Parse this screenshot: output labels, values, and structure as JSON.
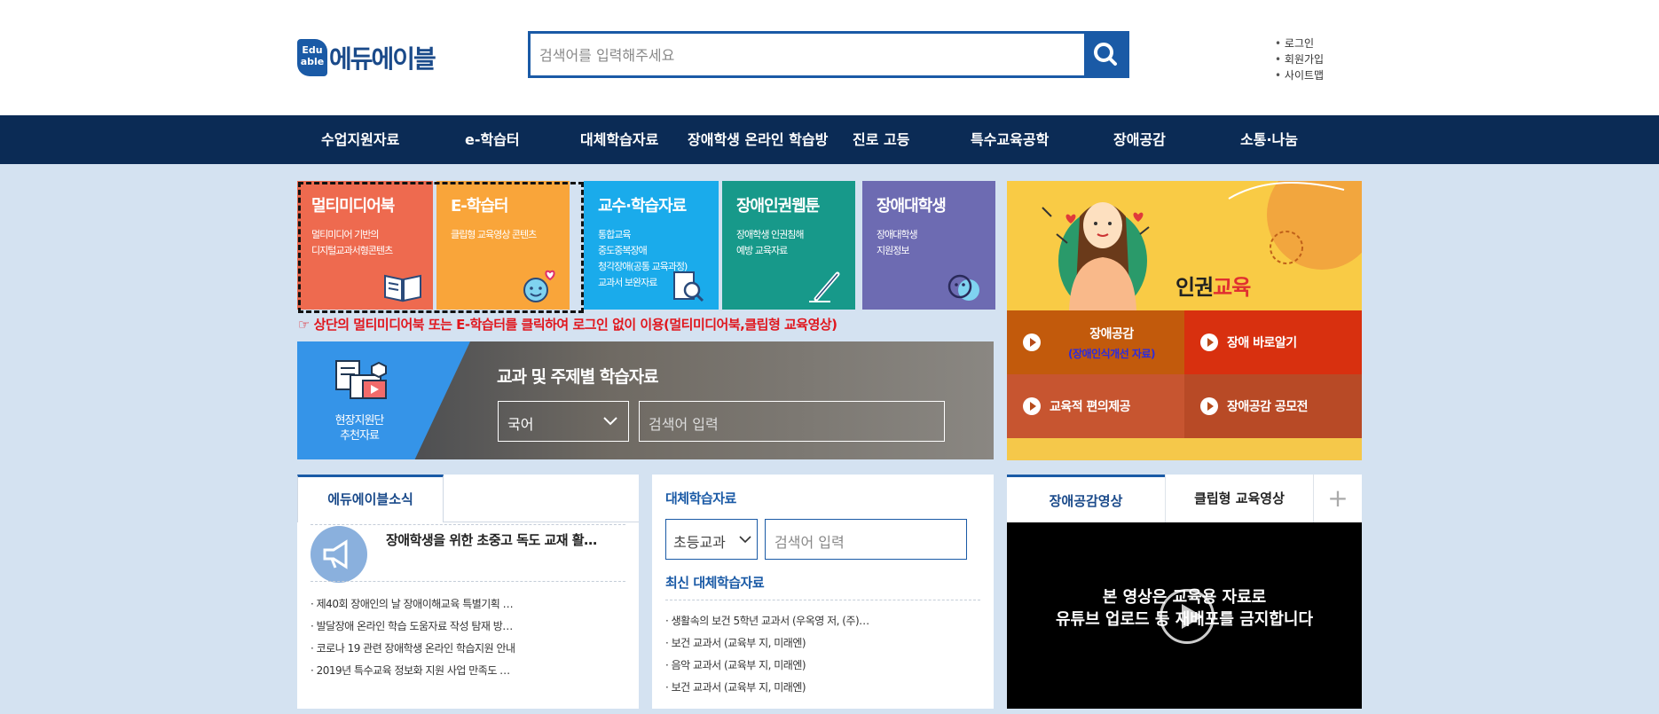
{
  "header": {
    "logo_badge": "Edu able",
    "logo_text": "에듀에이블",
    "search_placeholder": "검색어를 입력해주세요",
    "util_links": [
      "로그인",
      "회원가입",
      "사이트맵"
    ]
  },
  "gnb": [
    "수업지원자료",
    "e-학습터",
    "대체학습자료",
    "장애학생 온라인 학습방",
    "진로 고등",
    "특수교육공학",
    "장애공감",
    "소통·나눔"
  ],
  "tiles": [
    {
      "title": "멀티미디어북",
      "desc": [
        "멀티미디어 기반의",
        "디지털교과서형콘텐츠"
      ],
      "color": "#ee6a4f",
      "icon": "book-icon"
    },
    {
      "title": "E-학습터",
      "desc": [
        "클립형 교육영상 콘텐츠"
      ],
      "color": "#f9a53a",
      "icon": "smiley-heart-icon"
    },
    {
      "title": "교수·학습자료",
      "desc": [
        "통합교육",
        "중도중복장애",
        "청각장애(공통 교육과정)",
        "교과서 보완자료"
      ],
      "color": "#1aabeb",
      "icon": "document-search-icon"
    },
    {
      "title": "장애인권웹툰",
      "desc": [
        "장애학생 인권침해",
        "예방 교육자료"
      ],
      "color": "#17998a",
      "icon": "pen-icon"
    },
    {
      "title": "장애대학생",
      "desc": [
        "장애대학생",
        "지원정보"
      ],
      "color": "#6d6bb2",
      "icon": "faces-icon"
    }
  ],
  "notice": "☞ 상단의 멀티미디어북 또는 E-학습터를 클릭하여 로그인 없이 이용(멀티미디어북,클립형 교육영상)",
  "recommend": {
    "label": [
      "현장지원단",
      "추천자료"
    ],
    "title": "교과 및 주제별 학습자료",
    "select": "국어",
    "input_placeholder": "검색어 입력"
  },
  "promo": {
    "title_a": "인권",
    "title_b": "교육",
    "buttons": [
      {
        "label": "장애공감",
        "sub": "(장애인식개선 자료)",
        "color": "#c25a0c"
      },
      {
        "label": "장애 바로알기",
        "sub": "",
        "color": "#d8300f"
      },
      {
        "label": "교육적 편의제공",
        "sub": "",
        "color": "#c75530"
      },
      {
        "label": "장애공감 공모전",
        "sub": "",
        "color": "#b84a26"
      }
    ]
  },
  "news": {
    "tab": "에듀에이블소식",
    "headline": "장애학생을 위한 초중고 독도 교재 활…",
    "items": [
      "제40회 장애인의 날 장애이해교육 특별기획 …",
      "발달장애 온라인 학습 도움자료 작성 탐재 방…",
      "코로나 19 관련 장애학생 온라인 학습지원 안내",
      "2019년 특수교육 정보화 지원 사업 만족도 …"
    ]
  },
  "alt": {
    "title": "대체학습자료",
    "select": "초등교과",
    "input_placeholder": "검색어 입력",
    "subtitle": "최신 대체학습자료",
    "items": [
      "생활속의 보건 5학년 교과서 (우옥영 저, (주)…",
      "보건 교과서 (교육부 지, 미래엔)",
      "음악 교과서 (교육부 지, 미래엔)",
      "보건 교과서 (교육부 지, 미래엔)"
    ]
  },
  "video": {
    "tabs": [
      "장애공감영상",
      "클립형 교육영상"
    ],
    "more": "+",
    "message": [
      "본 영상은 교육용 자료로",
      "유튜브 업로드 등 재배포를 금지합니다"
    ]
  }
}
